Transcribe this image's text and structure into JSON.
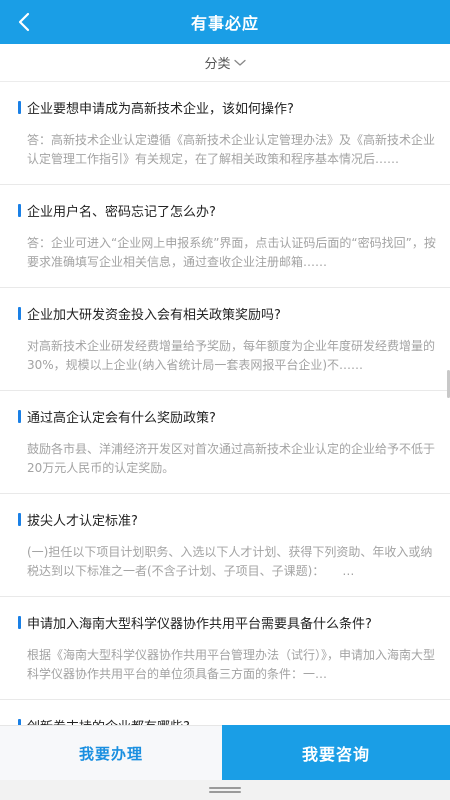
{
  "header": {
    "title": "有事必应",
    "back_icon": "chevron-left-icon"
  },
  "filter": {
    "label": "分类",
    "icon": "chevron-down-icon"
  },
  "items": [
    {
      "question": "企业要想申请成为高新技术企业，该如何操作?",
      "answer": "答：高新技术企业认定遵循《高新技术企业认定管理办法》及《高新技术企业认定管理工作指引》有关规定，在了解相关政策和程序基本情况后……"
    },
    {
      "question": "企业用户名、密码忘记了怎么办?",
      "answer": "答：企业可进入“企业网上申报系统”界面，点击认证码后面的“密码找回”，按要求准确填写企业相关信息，通过查收企业注册邮箱……"
    },
    {
      "question": "企业加大研发资金投入会有相关政策奖励吗?",
      "answer": "对高新技术企业研发经费增量给予奖励，每年额度为企业年度研发经费增量的30%，规模以上企业(纳入省统计局一套表网报平台企业)不……"
    },
    {
      "question": "通过高企认定会有什么奖励政策?",
      "answer": "鼓励各市县、洋浦经济开发区对首次通过高新技术企业认定的企业给予不低于20万元人民币的认定奖励。"
    },
    {
      "question": "拔尖人才认定标准?",
      "answer": "(一)担任以下项目计划职务、入选以下人才计划、获得下列资助、年收入或纳税达到以下标准之一者(不含子计划、子项目、子课题)：　　…"
    },
    {
      "question": "申请加入海南大型科学仪器协作共用平台需要具备什么条件?",
      "answer": "根据《海南大型科学仪器协作共用平台管理办法（试行）》，申请加入海南大型科学仪器协作共用平台的单位须具备三方面的条件：一…"
    },
    {
      "question": "创新券支持的企业都有哪些?",
      "answer": ""
    }
  ],
  "bottom": {
    "handle_label": "我要办理",
    "consult_label": "我要咨询"
  },
  "colors": {
    "primary": "#1a9ee6",
    "accent_bar": "#1a80e6",
    "answer_text": "#a3a3a3"
  }
}
